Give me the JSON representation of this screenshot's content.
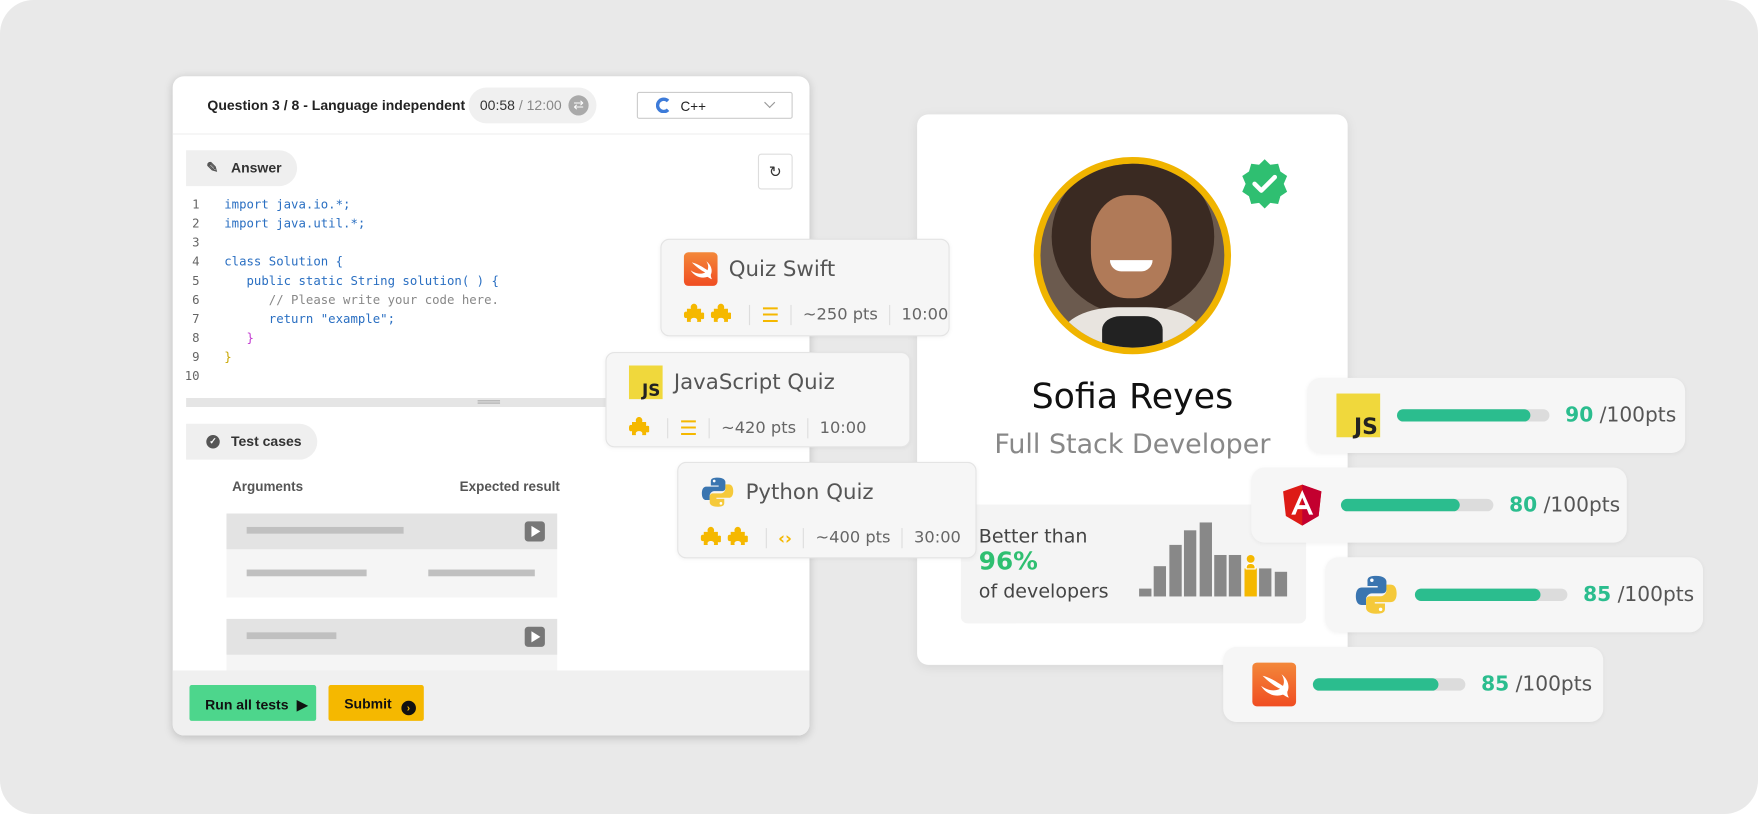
{
  "editor": {
    "question_label": "Question 3 / 8 - Language independent",
    "timer_elapsed": "00:58",
    "timer_total": "/ 12:00",
    "language": "C++",
    "answer_tab": "Answer",
    "code_lines": [
      {
        "n": "1",
        "text": "import java.io.*;"
      },
      {
        "n": "2",
        "text": "import java.util.*;"
      },
      {
        "n": "3",
        "text": ""
      },
      {
        "n": "4",
        "text": "class Solution {"
      },
      {
        "n": "5",
        "text": "   public static String solution( ) {"
      },
      {
        "n": "6",
        "text": "      // Please write your code here."
      },
      {
        "n": "7",
        "text": "      return \"example\";"
      },
      {
        "n": "8",
        "text": "   }"
      },
      {
        "n": "9",
        "text": "}"
      },
      {
        "n": "10",
        "text": ""
      }
    ],
    "test_cases_tab": "Test cases",
    "col_arguments": "Arguments",
    "col_expected": "Expected result",
    "run_all_label": "Run all tests",
    "submit_label": "Submit"
  },
  "quizzes": [
    {
      "name": "Quiz Swift",
      "logo": "swift-logo",
      "difficulty": 2,
      "type_icon": "list-icon",
      "points": "~250 pts",
      "time": "10:00"
    },
    {
      "name": "JavaScript Quiz",
      "logo": "javascript-logo",
      "difficulty": 1,
      "type_icon": "list-icon",
      "points": "~420 pts",
      "time": "10:00"
    },
    {
      "name": "Python Quiz",
      "logo": "python-logo",
      "difficulty": 2,
      "type_icon": "code-icon",
      "points": "~400 pts",
      "time": "30:00"
    }
  ],
  "profile": {
    "name": "Sofia Reyes",
    "role": "Full Stack Developer",
    "verified": true,
    "better_than": "Better than",
    "percent": "96%",
    "of_developers": "of developers",
    "histogram": [
      20,
      81,
      135,
      173,
      195,
      110,
      110,
      75,
      75,
      65
    ],
    "highlight_index": 7
  },
  "skills": [
    {
      "logo": "javascript-logo",
      "score": "90",
      "max": "/100pts",
      "value": 90
    },
    {
      "logo": "angular-logo",
      "score": "80",
      "max": "/100pts",
      "value": 80
    },
    {
      "logo": "python-logo",
      "score": "85",
      "max": "/100pts",
      "value": 85
    },
    {
      "logo": "swift-logo",
      "score": "85",
      "max": "/100pts",
      "value": 85
    }
  ],
  "colors": {
    "accent_green": "#2bbd8e",
    "accent_yellow": "#f5b800",
    "run_green": "#4dd68c",
    "verified": "#2fbf71"
  }
}
